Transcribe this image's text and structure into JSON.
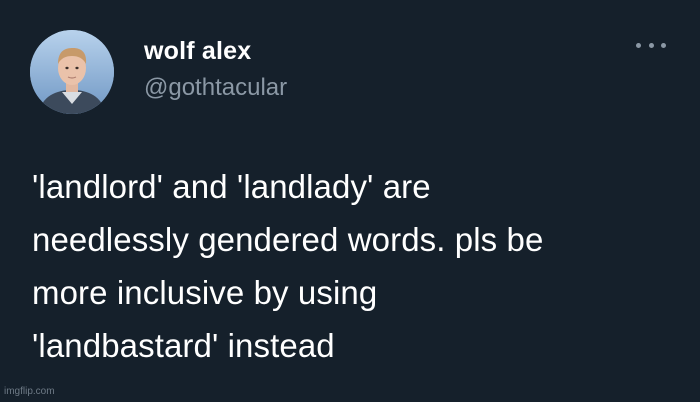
{
  "tweet": {
    "author": {
      "name": "wolf alex",
      "handle": "@gothtacular"
    },
    "text_lines": [
      "'landlord' and 'landlady' are",
      "needlessly gendered words. pls be",
      "more inclusive by using",
      "'landbastard' instead"
    ],
    "more_icon": "more-horizontal-icon"
  },
  "watermark": "imgflip.com",
  "colors": {
    "background": "#15202b",
    "text_primary": "#ffffff",
    "text_secondary": "#8b98a5"
  }
}
